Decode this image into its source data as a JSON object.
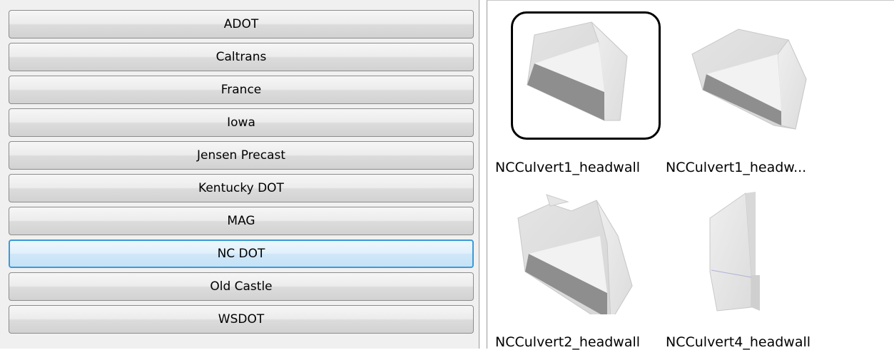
{
  "categories": [
    {
      "label": "ADOT",
      "selected": false
    },
    {
      "label": "Caltrans",
      "selected": false
    },
    {
      "label": "France",
      "selected": false
    },
    {
      "label": "Iowa",
      "selected": false
    },
    {
      "label": "Jensen Precast",
      "selected": false
    },
    {
      "label": "Kentucky DOT",
      "selected": false
    },
    {
      "label": "MAG",
      "selected": false
    },
    {
      "label": "NC DOT",
      "selected": true
    },
    {
      "label": "Old Castle",
      "selected": false
    },
    {
      "label": "WSDOT",
      "selected": false
    }
  ],
  "items": [
    {
      "label": "NCCulvert1_headwall",
      "selected": true
    },
    {
      "label": "NCCulvert1_headw...",
      "selected": false
    },
    {
      "label": "NCCulvert2_headwall",
      "selected": false
    },
    {
      "label": "NCCulvert4_headwall",
      "selected": false
    }
  ]
}
